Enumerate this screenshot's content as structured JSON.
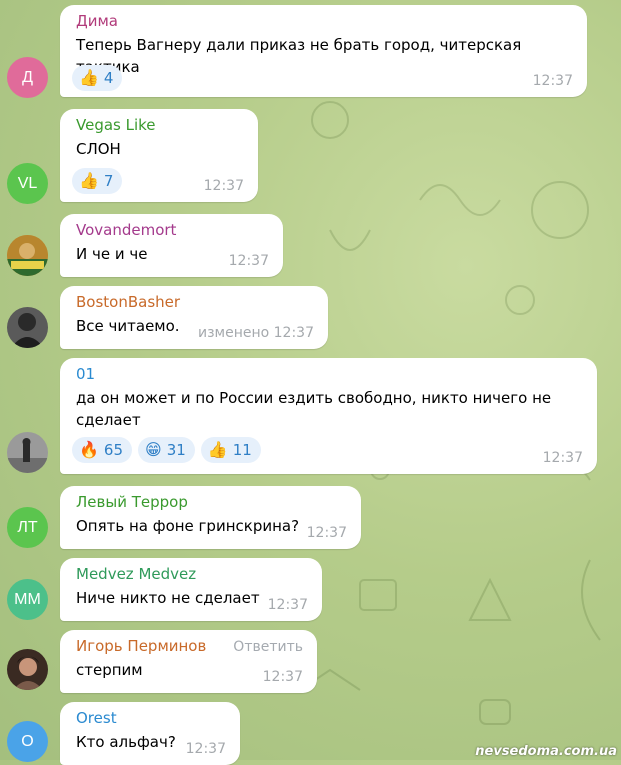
{
  "colors": {
    "bubble": "#ffffff",
    "reaction_bg": "#e6f0fb",
    "reaction_text": "#2f7fc6",
    "time": "#a5a9ad"
  },
  "messages": [
    {
      "initials": "Д",
      "avatar_color": "#e06b9a",
      "name": "Дима",
      "name_color": "#b13a7a",
      "text": "Теперь Вагнеру дали приказ не брать город, читерская тактика",
      "time": "12:37",
      "reactions": [
        {
          "emoji": "👍",
          "icon": "thumbs-up",
          "count": "4"
        }
      ]
    },
    {
      "initials": "VL",
      "avatar_color": "#5bc54e",
      "name": "Vegas Like",
      "name_color": "#3a9a2e",
      "text": "СЛОН",
      "time": "12:37",
      "reactions": [
        {
          "emoji": "👍",
          "icon": "thumbs-up",
          "count": "7"
        }
      ]
    },
    {
      "initials": "",
      "avatar_color": "#c79a3a",
      "name": "Vovandemort",
      "name_color": "#a43a8c",
      "text": "И че и че",
      "time": "12:37",
      "reactions": []
    },
    {
      "initials": "",
      "avatar_color": "#4a4a4a",
      "name": "BostonBasher",
      "name_color": "#c86a2a",
      "text": "Все читаемо.",
      "time": "изменено 12:37",
      "reactions": []
    },
    {
      "initials": "",
      "avatar_color": "#8a8a8a",
      "name": "01",
      "name_color": "#2a8ad0",
      "text": "да он может и по России ездить свободно, никто ничего не сделает",
      "time": "12:37",
      "reactions": [
        {
          "emoji": "🔥",
          "icon": "fire",
          "count": "65"
        },
        {
          "emoji": "😁",
          "icon": "grin",
          "count": "31"
        },
        {
          "emoji": "👍",
          "icon": "thumbs-up",
          "count": "11"
        }
      ]
    },
    {
      "initials": "ЛТ",
      "avatar_color": "#5bc54e",
      "name": "Левый Террор",
      "name_color": "#3a9a2e",
      "text": "Опять на фоне гринскрина?",
      "time": "12:37",
      "reactions": []
    },
    {
      "initials": "MM",
      "avatar_color": "#4cc08a",
      "name": "Medvez Medvez",
      "name_color": "#2f9a5a",
      "text": "Ниче никто не сделает",
      "time": "12:37",
      "reactions": []
    },
    {
      "initials": "",
      "avatar_color": "#6a4a3a",
      "name": "Игорь Перминов",
      "name_color": "#c86a2a",
      "reply": "Ответить",
      "text": "стерпим",
      "time": "12:37",
      "reactions": []
    },
    {
      "initials": "О",
      "avatar_color": "#4aa3e8",
      "name": "Orest",
      "name_color": "#2a8ad0",
      "text": "Кто альфач?",
      "time": "12:37",
      "reactions": []
    }
  ],
  "watermark": "nevsedoma.com.ua"
}
